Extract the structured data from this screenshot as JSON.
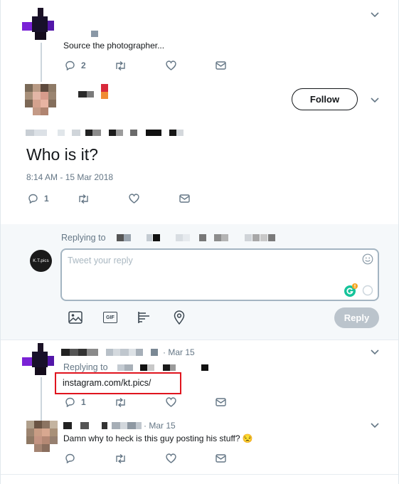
{
  "tweet1": {
    "text": "Source the photographer...",
    "reply_count": "2"
  },
  "tweet2": {
    "follow_label": "Follow",
    "text": "Who is it?",
    "timestamp": "8:14 AM - 15 Mar 2018",
    "reply_count": "1"
  },
  "compose": {
    "replying_to_label": "Replying to",
    "placeholder": "Tweet your reply",
    "avatar_text": "K.T.pics",
    "reply_button": "Reply",
    "gif_label": "GIF"
  },
  "tweet3": {
    "date": "· Mar 15",
    "replying_to_label": "Replying to",
    "text": "instagram.com/kt.pics/",
    "reply_count": "1",
    "highlight_color": "#e0141e"
  },
  "tweet4": {
    "date": "· Mar 15",
    "text": "Damn why to heck is this guy posting his stuff? 😒"
  },
  "colors": {
    "accent": "#1da1f2",
    "icon_gray": "#657786",
    "grammarly_green": "#15c39a"
  },
  "icons": [
    "chevron-down-icon",
    "reply-icon",
    "retweet-icon",
    "like-icon",
    "dm-icon",
    "emoji-icon",
    "grammarly-icon",
    "image-icon",
    "gif-icon",
    "poll-icon",
    "location-icon"
  ]
}
